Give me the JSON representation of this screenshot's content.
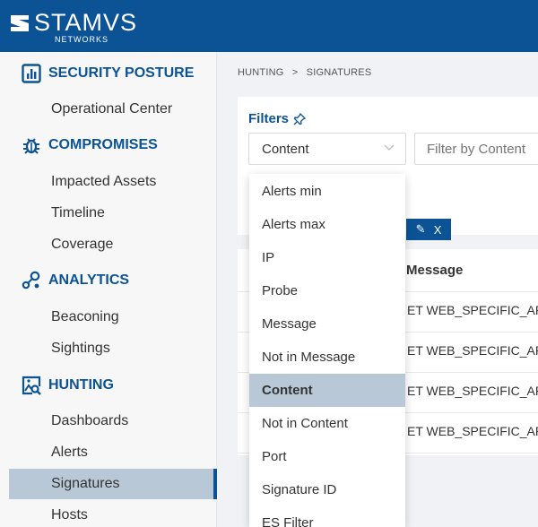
{
  "brand": {
    "name": "STAMVS",
    "sub": "NETWORKS",
    "color": "#0b5394"
  },
  "sidebar": {
    "sections": [
      {
        "label": "SECURITY POSTURE",
        "icon": "bar-chart-icon",
        "items": [
          "Operational Center"
        ]
      },
      {
        "label": "COMPROMISES",
        "icon": "bug-icon",
        "items": [
          "Impacted Assets",
          "Timeline",
          "Coverage"
        ]
      },
      {
        "label": "ANALYTICS",
        "icon": "nodes-icon",
        "items": [
          "Beaconing",
          "Sightings"
        ]
      },
      {
        "label": "HUNTING",
        "icon": "image-search-icon",
        "items": [
          "Dashboards",
          "Alerts",
          "Signatures",
          "Hosts"
        ]
      }
    ],
    "active_item": "Signatures"
  },
  "breadcrumb": {
    "parent": "HUNTING",
    "separator": ">",
    "current": "SIGNATURES"
  },
  "filters": {
    "title": "Filters",
    "select_value": "Content",
    "input_placeholder": "Filter by Content",
    "tag_edit_symbol": "✎",
    "tag_close_symbol": "X"
  },
  "dropdown": {
    "options": [
      "Alerts min",
      "Alerts max",
      "IP",
      "Probe",
      "Message",
      "Not in Message",
      "Content",
      "Not in Content",
      "Port",
      "Signature ID",
      "ES Filter"
    ],
    "selected": "Content"
  },
  "table": {
    "columns": [
      "Message"
    ],
    "rows": [
      "ET WEB_SPECIFIC_APPS",
      "ET WEB_SPECIFIC_APPS",
      "ET WEB_SPECIFIC_APPS",
      "ET WEB_SPECIFIC_APPS"
    ]
  }
}
